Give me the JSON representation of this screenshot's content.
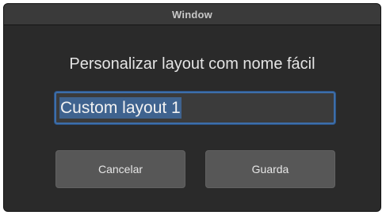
{
  "window": {
    "title": "Window"
  },
  "dialog": {
    "prompt": "Personalizar layout com nome fácil",
    "name_input": {
      "value": "Custom layout 1",
      "selected": true
    },
    "cancel_label": "Cancelar",
    "save_label": "Guarda"
  },
  "colors": {
    "background": "#2a2a2a",
    "titlebar": "#3a3a3a",
    "input_focus_border": "#3d6eaa",
    "selection": "#3f638f",
    "button": "#575757"
  }
}
